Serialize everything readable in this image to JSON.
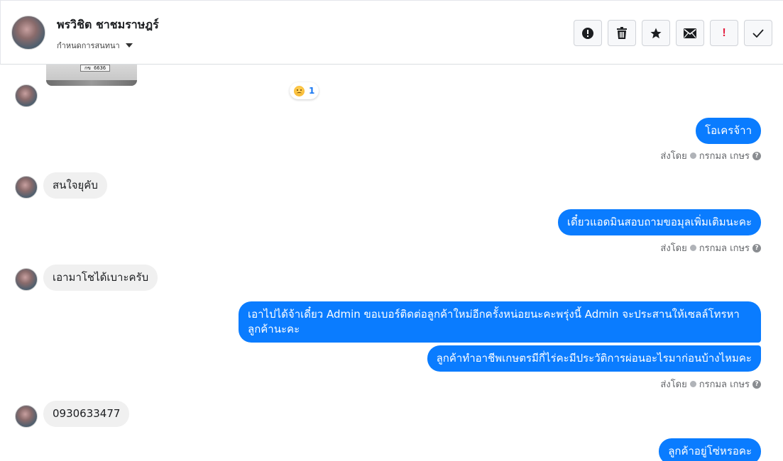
{
  "header": {
    "contact_name": "พรวิชิต ชาชมราษฎร์",
    "subtitle": "กำหนดการสนทนา",
    "actions": [
      {
        "icon": "exclamation-circle-icon"
      },
      {
        "icon": "trash-icon"
      },
      {
        "icon": "star-icon"
      },
      {
        "icon": "envelope-icon"
      },
      {
        "icon": "exclamation-icon",
        "label": "!"
      },
      {
        "icon": "check-icon"
      }
    ]
  },
  "thread": {
    "photo": {
      "plate_text": "กข 6636"
    },
    "reaction": {
      "emoji": "angry-emoji-icon",
      "count": "1"
    },
    "messages": [
      {
        "dir": "out",
        "text": "โอเครจ้าา"
      },
      {
        "dir": "in",
        "text": "สนใจยุคับ"
      },
      {
        "dir": "out",
        "text": "เดี๋ยวแอดมินสอบถามขอมุลเพิ่มเติมนะคะ"
      },
      {
        "dir": "in",
        "text": "เอามาโชได้เบาะครับ"
      },
      {
        "dir": "out",
        "text": "เอาไปได้จ้าเดี๋ยว Admin ขอเบอร์ติดต่อลูกค้าใหม่อีกครั้งหน่อยนะคะพรุ่งนี้ Admin จะประสานให้เซลล์โทรหาลูกค้านะคะ"
      },
      {
        "dir": "out",
        "text": "ลูกค้าทำอาชีพเกษตรมีกี่ไร่คะมีประวัติการผ่อนอะไรมาก่อนบ้างไหมคะ"
      },
      {
        "dir": "in",
        "text": "0930633477"
      },
      {
        "dir": "out",
        "text": "ลูกค้าอยู่โซ่หรอคะ"
      }
    ],
    "sent_by": {
      "prefix": "ส่งโดย",
      "name": "กรกมล เกษร"
    }
  },
  "colors": {
    "outgoing_bubble": "#0a7cff",
    "incoming_bubble": "#f0f0f0",
    "meta_text": "#65676b"
  }
}
